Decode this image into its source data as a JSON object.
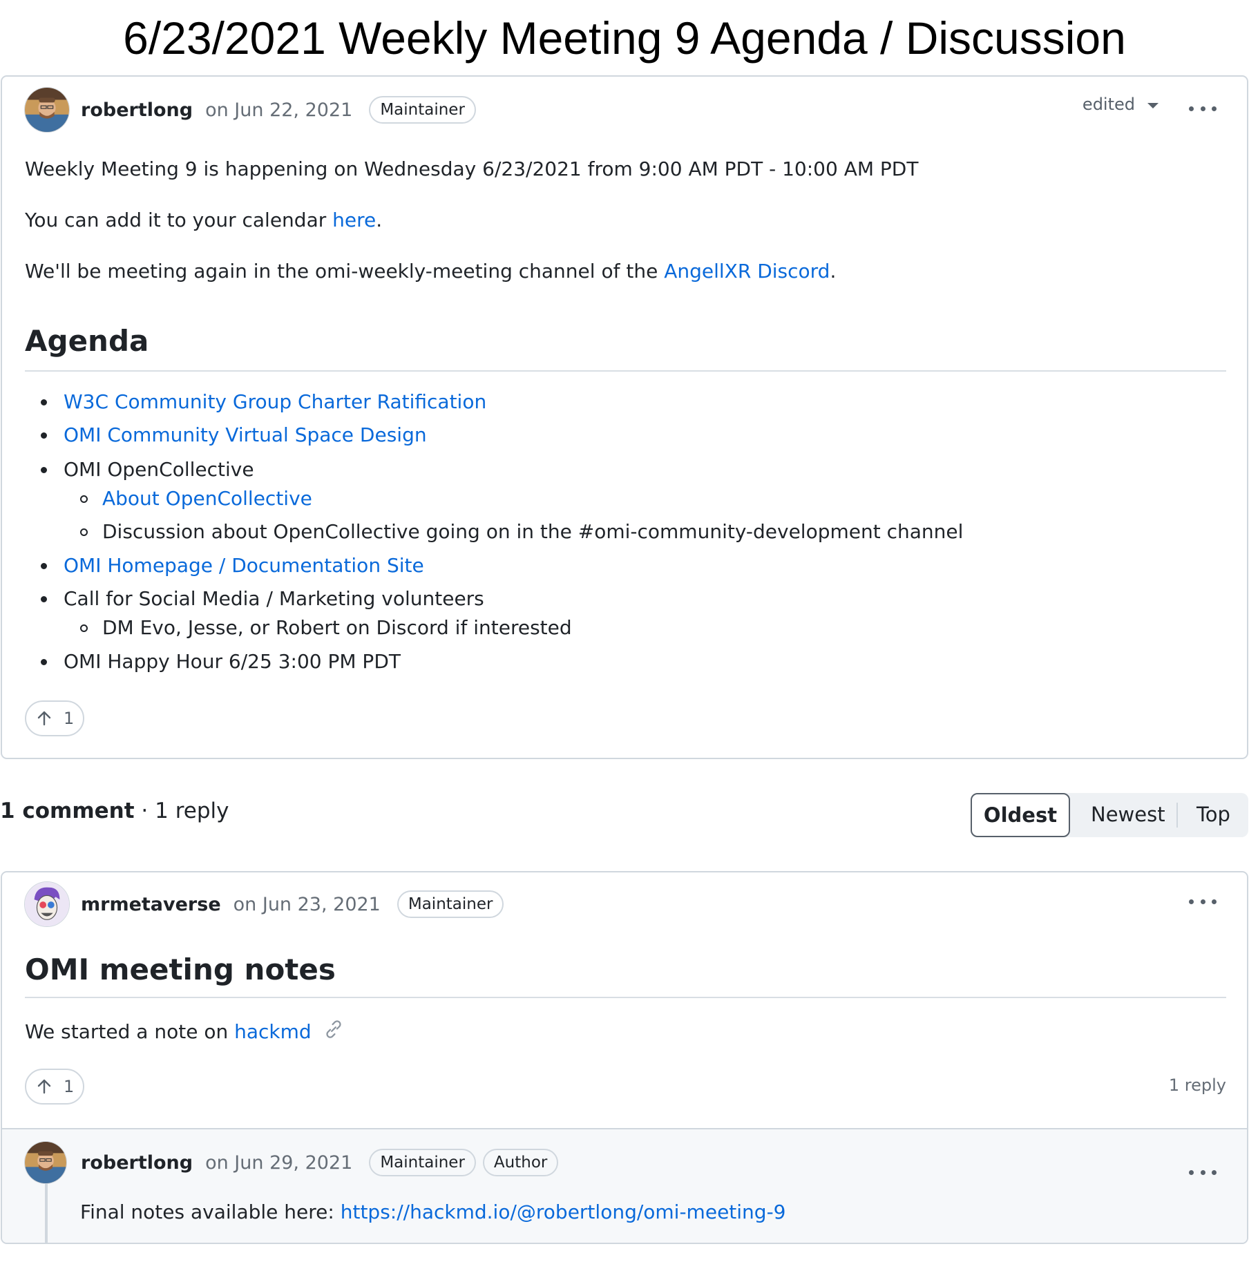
{
  "page_title": "6/23/2021 Weekly Meeting 9 Agenda / Discussion",
  "post": {
    "author": "robertlong",
    "date": "on Jun 22, 2021",
    "badge": "Maintainer",
    "edited_label": "edited",
    "line1": "Weekly Meeting 9 is happening on Wednesday 6/23/2021 from 9:00 AM PDT - 10:00 AM PDT",
    "line2_prefix": "You can add it to your calendar ",
    "line2_link": "here",
    "line2_suffix": ".",
    "line3_prefix": "We'll be meeting again in the omi-weekly-meeting channel of the ",
    "line3_link": "AngellXR Discord",
    "line3_suffix": ".",
    "agenda_heading": "Agenda",
    "agenda": [
      {
        "text": "W3C Community Group Charter Ratification",
        "link": true
      },
      {
        "text": "OMI Community Virtual Space Design",
        "link": true
      },
      {
        "text": "OMI OpenCollective",
        "link": false
      },
      {
        "text": "About OpenCollective",
        "link": true,
        "sub": true
      },
      {
        "text": "Discussion about OpenCollective going on in the #omi-community-development channel",
        "link": false,
        "sub": true
      },
      {
        "text": "OMI Homepage / Documentation Site",
        "link": true
      },
      {
        "text": "Call for Social Media / Marketing volunteers",
        "link": false
      },
      {
        "text": "DM Evo, Jesse, or Robert on Discord if interested",
        "link": false,
        "sub": true
      },
      {
        "text": "OMI Happy Hour 6/25 3:00 PM PDT",
        "link": false
      }
    ],
    "upvotes": "1"
  },
  "summary": {
    "comments": "1 comment",
    "separator": " · ",
    "replies": "1 reply"
  },
  "sort": {
    "oldest": "Oldest",
    "newest": "Newest",
    "top": "Top"
  },
  "comment": {
    "author": "mrmetaverse",
    "date": "on Jun 23, 2021",
    "badge": "Maintainer",
    "heading": "OMI meeting notes",
    "text_prefix": "We started a note on ",
    "text_link": "hackmd",
    "upvotes": "1",
    "reply_count": "1 reply"
  },
  "reply": {
    "author": "robertlong",
    "date": "on Jun 29, 2021",
    "badge1": "Maintainer",
    "badge2": "Author",
    "text_prefix": "Final notes available here: ",
    "text_link": "https://hackmd.io/@robertlong/omi-meeting-9"
  },
  "icons": {
    "more": "kebab-horizontal-icon",
    "upvote": "arrow-up-icon",
    "link": "link-icon",
    "caret": "triangle-down-icon"
  },
  "colors": {
    "link": "#0969da",
    "border": "#d0d7de",
    "muted": "#656d76"
  }
}
